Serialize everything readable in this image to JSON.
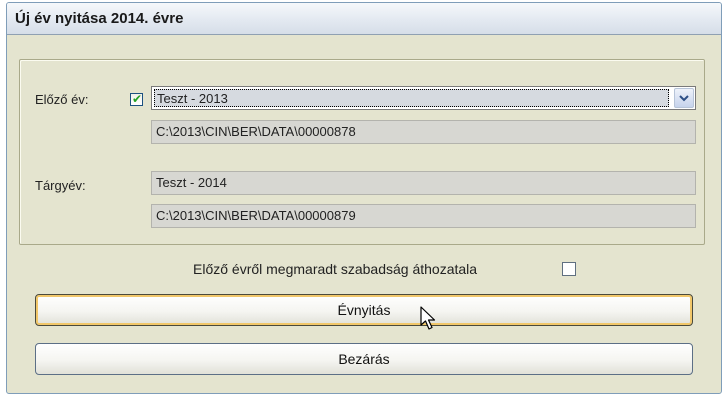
{
  "dialog": {
    "title": "Új év nyitása 2014. évre"
  },
  "previous_year": {
    "label": "Előző év:",
    "checked": true,
    "check_glyph": "✔",
    "selected": "Teszt - 2013",
    "path": "C:\\2013\\CIN\\BER\\DATA\\00000878"
  },
  "target_year": {
    "label": "Tárgyév:",
    "name": "Teszt - 2014",
    "path": "C:\\2013\\CIN\\BER\\DATA\\00000879"
  },
  "carry_leave": {
    "label": "Előző évről megmaradt szabadság áthozatala",
    "checked": false
  },
  "buttons": {
    "open_year": "Évnyitás",
    "close": "Bezárás"
  },
  "colors": {
    "dialog_bg": "#e4e4cf",
    "check_green": "#21a121",
    "focus_ring": "#f1c76a"
  }
}
